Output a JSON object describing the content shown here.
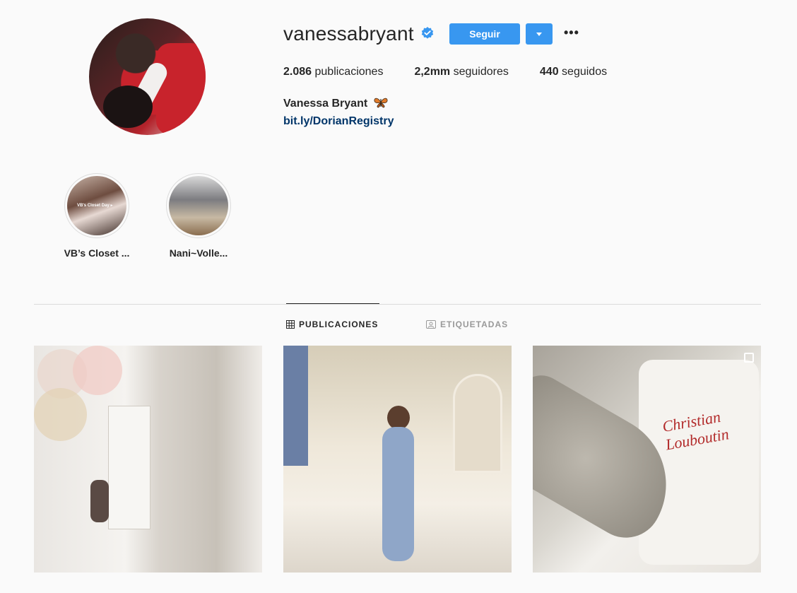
{
  "profile": {
    "username": "vanessabryant",
    "verified": true,
    "follow_label": "Seguir",
    "more_label": "•••",
    "stats": {
      "posts_count": "2.086",
      "posts_label": "publicaciones",
      "followers_count": "2,2mm",
      "followers_label": "seguidores",
      "following_count": "440",
      "following_label": "seguidos"
    },
    "full_name": "Vanessa Bryant",
    "bio_link": "bit.ly/DorianRegistry"
  },
  "highlights": [
    {
      "label": "VB’s Closet ...",
      "cover_text": "VB's Closet Day ▸"
    },
    {
      "label": "Nani~Volle..."
    }
  ],
  "tabs": [
    {
      "label": "PUBLICACIONES",
      "active": true,
      "icon": "grid-icon"
    },
    {
      "label": "ETIQUETADAS",
      "active": false,
      "icon": "tagged-icon"
    }
  ],
  "posts": [
    {
      "id": "post-1"
    },
    {
      "id": "post-2"
    },
    {
      "id": "post-3",
      "logo_text": "Christian Louboutin",
      "multi": true
    }
  ],
  "colors": {
    "accent": "#3897f0",
    "link": "#003569",
    "background": "#fafafa"
  }
}
